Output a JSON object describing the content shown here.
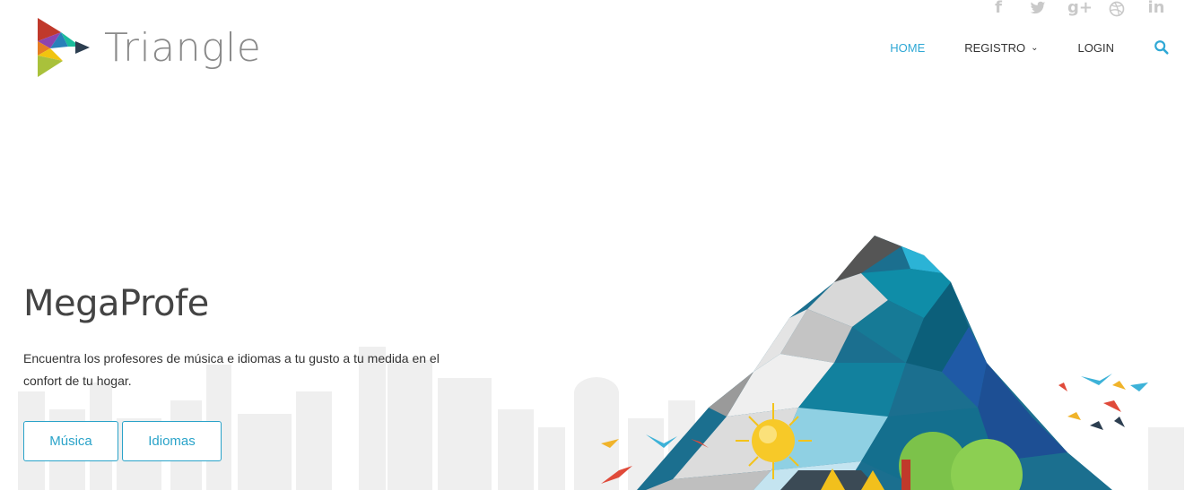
{
  "logo": {
    "text": "Triangle"
  },
  "social": [
    {
      "icon": "facebook-icon",
      "glyph": "f"
    },
    {
      "icon": "twitter-icon",
      "glyph": "🐦"
    },
    {
      "icon": "google-plus-icon",
      "glyph": "g+"
    },
    {
      "icon": "dribbble-icon",
      "glyph": "◎"
    },
    {
      "icon": "linkedin-icon",
      "glyph": "in"
    }
  ],
  "nav": {
    "home": "HOME",
    "registro": "REGISTRO",
    "login": "LOGIN"
  },
  "hero": {
    "title": "MegaProfe",
    "description": "Encuentra los profesores de música e idiomas a tu gusto a tu medida en el confort de tu hogar.",
    "btn_musica": "Música",
    "btn_idiomas": "Idiomas"
  },
  "colors": {
    "accent": "#2fa8d5",
    "button_border": "#2aa3c9",
    "nav_text": "#333333"
  }
}
